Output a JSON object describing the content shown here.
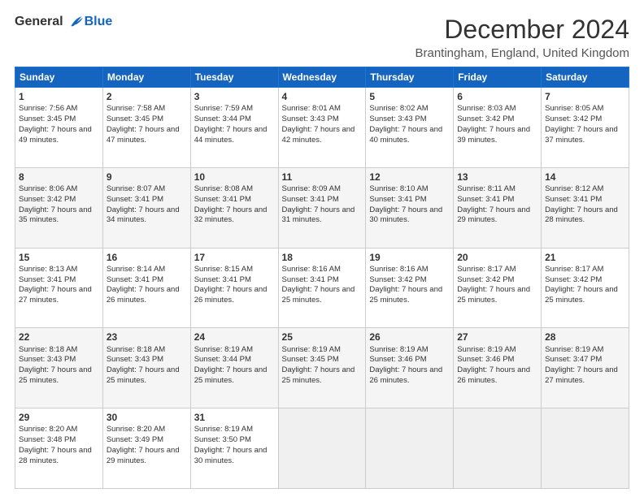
{
  "logo": {
    "general": "General",
    "blue": "Blue"
  },
  "title": "December 2024",
  "location": "Brantingham, England, United Kingdom",
  "days_header": [
    "Sunday",
    "Monday",
    "Tuesday",
    "Wednesday",
    "Thursday",
    "Friday",
    "Saturday"
  ],
  "weeks": [
    [
      {
        "day": 1,
        "sunrise": "7:56 AM",
        "sunset": "3:45 PM",
        "daylight": "7 hours and 49 minutes."
      },
      {
        "day": 2,
        "sunrise": "7:58 AM",
        "sunset": "3:45 PM",
        "daylight": "7 hours and 47 minutes."
      },
      {
        "day": 3,
        "sunrise": "7:59 AM",
        "sunset": "3:44 PM",
        "daylight": "7 hours and 44 minutes."
      },
      {
        "day": 4,
        "sunrise": "8:01 AM",
        "sunset": "3:43 PM",
        "daylight": "7 hours and 42 minutes."
      },
      {
        "day": 5,
        "sunrise": "8:02 AM",
        "sunset": "3:43 PM",
        "daylight": "7 hours and 40 minutes."
      },
      {
        "day": 6,
        "sunrise": "8:03 AM",
        "sunset": "3:42 PM",
        "daylight": "7 hours and 39 minutes."
      },
      {
        "day": 7,
        "sunrise": "8:05 AM",
        "sunset": "3:42 PM",
        "daylight": "7 hours and 37 minutes."
      }
    ],
    [
      {
        "day": 8,
        "sunrise": "8:06 AM",
        "sunset": "3:42 PM",
        "daylight": "7 hours and 35 minutes."
      },
      {
        "day": 9,
        "sunrise": "8:07 AM",
        "sunset": "3:41 PM",
        "daylight": "7 hours and 34 minutes."
      },
      {
        "day": 10,
        "sunrise": "8:08 AM",
        "sunset": "3:41 PM",
        "daylight": "7 hours and 32 minutes."
      },
      {
        "day": 11,
        "sunrise": "8:09 AM",
        "sunset": "3:41 PM",
        "daylight": "7 hours and 31 minutes."
      },
      {
        "day": 12,
        "sunrise": "8:10 AM",
        "sunset": "3:41 PM",
        "daylight": "7 hours and 30 minutes."
      },
      {
        "day": 13,
        "sunrise": "8:11 AM",
        "sunset": "3:41 PM",
        "daylight": "7 hours and 29 minutes."
      },
      {
        "day": 14,
        "sunrise": "8:12 AM",
        "sunset": "3:41 PM",
        "daylight": "7 hours and 28 minutes."
      }
    ],
    [
      {
        "day": 15,
        "sunrise": "8:13 AM",
        "sunset": "3:41 PM",
        "daylight": "7 hours and 27 minutes."
      },
      {
        "day": 16,
        "sunrise": "8:14 AM",
        "sunset": "3:41 PM",
        "daylight": "7 hours and 26 minutes."
      },
      {
        "day": 17,
        "sunrise": "8:15 AM",
        "sunset": "3:41 PM",
        "daylight": "7 hours and 26 minutes."
      },
      {
        "day": 18,
        "sunrise": "8:16 AM",
        "sunset": "3:41 PM",
        "daylight": "7 hours and 25 minutes."
      },
      {
        "day": 19,
        "sunrise": "8:16 AM",
        "sunset": "3:42 PM",
        "daylight": "7 hours and 25 minutes."
      },
      {
        "day": 20,
        "sunrise": "8:17 AM",
        "sunset": "3:42 PM",
        "daylight": "7 hours and 25 minutes."
      },
      {
        "day": 21,
        "sunrise": "8:17 AM",
        "sunset": "3:42 PM",
        "daylight": "7 hours and 25 minutes."
      }
    ],
    [
      {
        "day": 22,
        "sunrise": "8:18 AM",
        "sunset": "3:43 PM",
        "daylight": "7 hours and 25 minutes."
      },
      {
        "day": 23,
        "sunrise": "8:18 AM",
        "sunset": "3:43 PM",
        "daylight": "7 hours and 25 minutes."
      },
      {
        "day": 24,
        "sunrise": "8:19 AM",
        "sunset": "3:44 PM",
        "daylight": "7 hours and 25 minutes."
      },
      {
        "day": 25,
        "sunrise": "8:19 AM",
        "sunset": "3:45 PM",
        "daylight": "7 hours and 25 minutes."
      },
      {
        "day": 26,
        "sunrise": "8:19 AM",
        "sunset": "3:46 PM",
        "daylight": "7 hours and 26 minutes."
      },
      {
        "day": 27,
        "sunrise": "8:19 AM",
        "sunset": "3:46 PM",
        "daylight": "7 hours and 26 minutes."
      },
      {
        "day": 28,
        "sunrise": "8:19 AM",
        "sunset": "3:47 PM",
        "daylight": "7 hours and 27 minutes."
      }
    ],
    [
      {
        "day": 29,
        "sunrise": "8:20 AM",
        "sunset": "3:48 PM",
        "daylight": "7 hours and 28 minutes."
      },
      {
        "day": 30,
        "sunrise": "8:20 AM",
        "sunset": "3:49 PM",
        "daylight": "7 hours and 29 minutes."
      },
      {
        "day": 31,
        "sunrise": "8:19 AM",
        "sunset": "3:50 PM",
        "daylight": "7 hours and 30 minutes."
      },
      null,
      null,
      null,
      null
    ]
  ]
}
